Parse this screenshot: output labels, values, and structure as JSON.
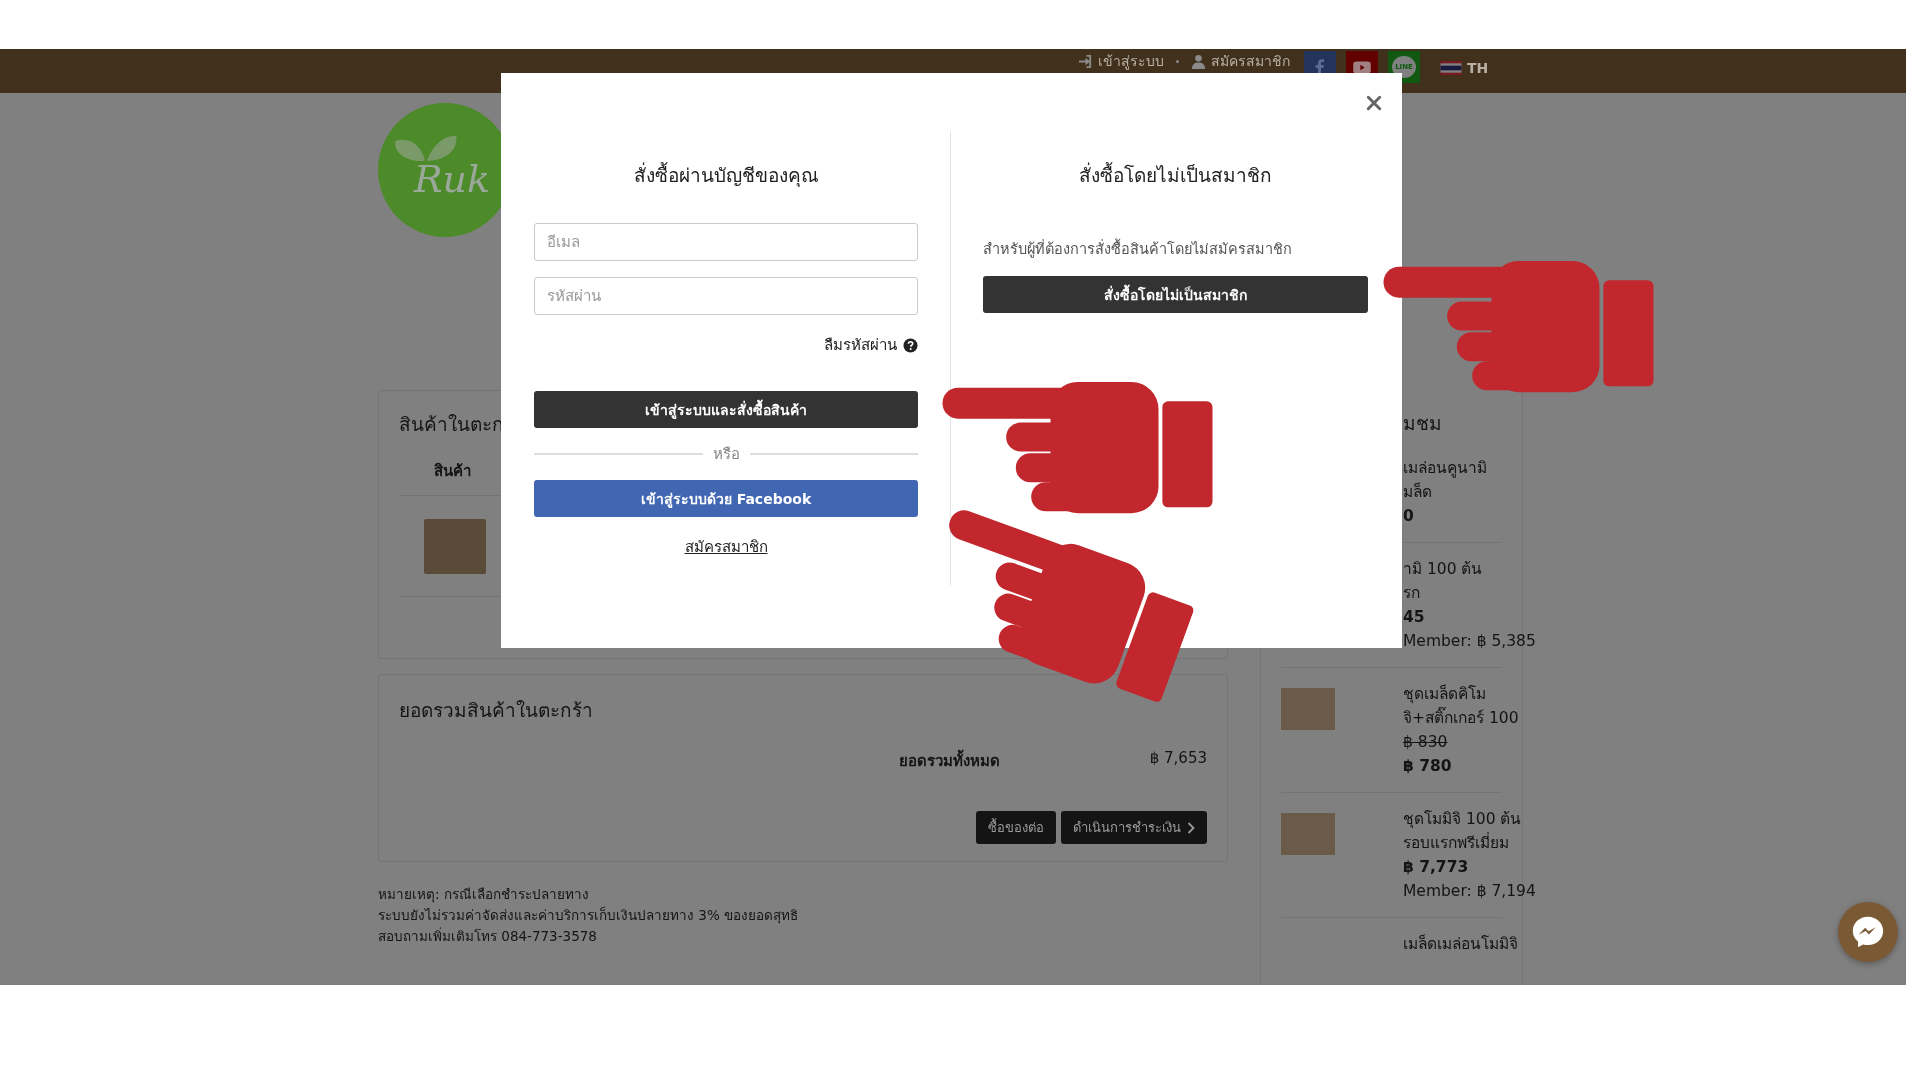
{
  "top_bar": {
    "links": [
      {
        "kind": "login",
        "label": "เข้าสู่ระบบ"
      },
      {
        "kind": "register",
        "label": "สมัครสมาชิก"
      }
    ],
    "social": [
      {
        "kind": "facebook"
      },
      {
        "kind": "youtube"
      },
      {
        "kind": "line",
        "label": "LINE"
      }
    ],
    "language": "TH"
  },
  "logo": {
    "text": "Ruk"
  },
  "cart": {
    "title": "สินค้าในตะก",
    "column": "สินค้า"
  },
  "totals": {
    "title": "ยอดรวมสินค้าในตะกร้า",
    "label": "ยอดรวมทั้งหมด",
    "amount": "฿ 7,653",
    "buttons": [
      {
        "kind": "plain",
        "label": "ซื้อของต่อ"
      },
      {
        "kind": "next",
        "label": "ดำเนินการชำระเงิน"
      }
    ]
  },
  "notes": [
    "หมายเหตุ: กรณีเลือกชำระปลายทาง",
    "ระบบยังไม่รวมค่าจัดส่งและค่าบริการเก็บเงินปลายทาง 3% ของยอดสุทธิ",
    "สอบถามเพิ่มเติมโทร 084-773-3578"
  ],
  "sidebar": {
    "title": "มชม",
    "items": [
      {
        "image": false,
        "name_lines": [
          "เมล่อนคูนามิ",
          "มล็ด"
        ],
        "price": "0"
      },
      {
        "image": false,
        "name_lines": [
          "ามิ 100 ต้น",
          "รก"
        ],
        "price": "45",
        "member_price": "Member: ฿ 5,385"
      },
      {
        "image": true,
        "name_lines": [
          "ชุดเมล็ดคิโม",
          "จิ+สติ๊กเกอร์ 100"
        ],
        "old_price": "฿ 830",
        "price": "฿ 780"
      },
      {
        "image": true,
        "name_lines": [
          "ชุดโมมิจิ 100 ต้น",
          "รอบแรกพรีเมี่ยม"
        ],
        "price": "฿ 7,773",
        "member_price": "Member: ฿ 7,194"
      },
      {
        "image": false,
        "name_lines": [
          "เมล็ดเมล่อนโมมิจิ"
        ]
      }
    ]
  },
  "modal": {
    "left": {
      "title": "สั่งซื้อผ่านบัญชีของคุณ",
      "email_placeholder": "อีเมล",
      "password_placeholder": "รหัสผ่าน",
      "forgot": "ลืมรหัสผ่าน",
      "login_button": "เข้าสู่ระบบและสั่งซื้อสินค้า",
      "or": "หรือ",
      "facebook_button": "เข้าสู่ระบบด้วย Facebook",
      "register_link": "สมัครสมาชิก"
    },
    "right": {
      "title": "สั่งซื้อโดยไม่เป็นสมาชิก",
      "description": "สำหรับผู้ที่ต้องการสั่งซื้อสินค้าโดยไม่สมัครสมาชิก",
      "guest_button": "สั่งซื้อโดยไม่เป็นสมาชิก"
    }
  }
}
